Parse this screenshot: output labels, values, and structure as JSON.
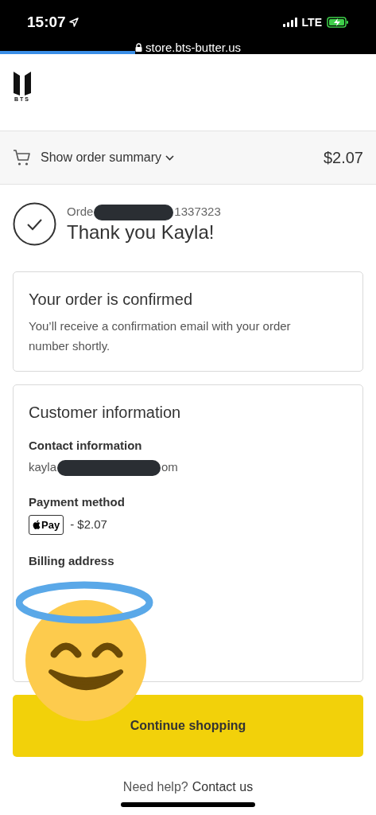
{
  "status_bar": {
    "time": "15:07",
    "network": "LTE"
  },
  "browser": {
    "url": "store.bts-butter.us",
    "load_progress": {
      "level": 0.36
    }
  },
  "header": {
    "logo_text": "BTS"
  },
  "order_summary": {
    "label": "Show order summary",
    "total": "$2.07",
    "expanded": false
  },
  "order": {
    "number_start": "Orde",
    "number_end": "1337323",
    "greeting": "Thank you Kayla!"
  },
  "confirmation": {
    "title": "Your order is confirmed",
    "text": "You’ll receive a confirmation email with your order number shortly."
  },
  "customer": {
    "title": "Customer information",
    "sections": [
      {
        "kind": "contact",
        "label": "Contact information",
        "start": "kayla",
        "end": "om"
      },
      {
        "kind": "payment",
        "label": "Payment method",
        "badge": "Pay",
        "amount": "- $2.07"
      },
      {
        "kind": "billing",
        "label": "Billing address"
      }
    ]
  },
  "continue_button": "Continue shopping",
  "help": {
    "text": "Need help?",
    "link": "Contact us"
  }
}
